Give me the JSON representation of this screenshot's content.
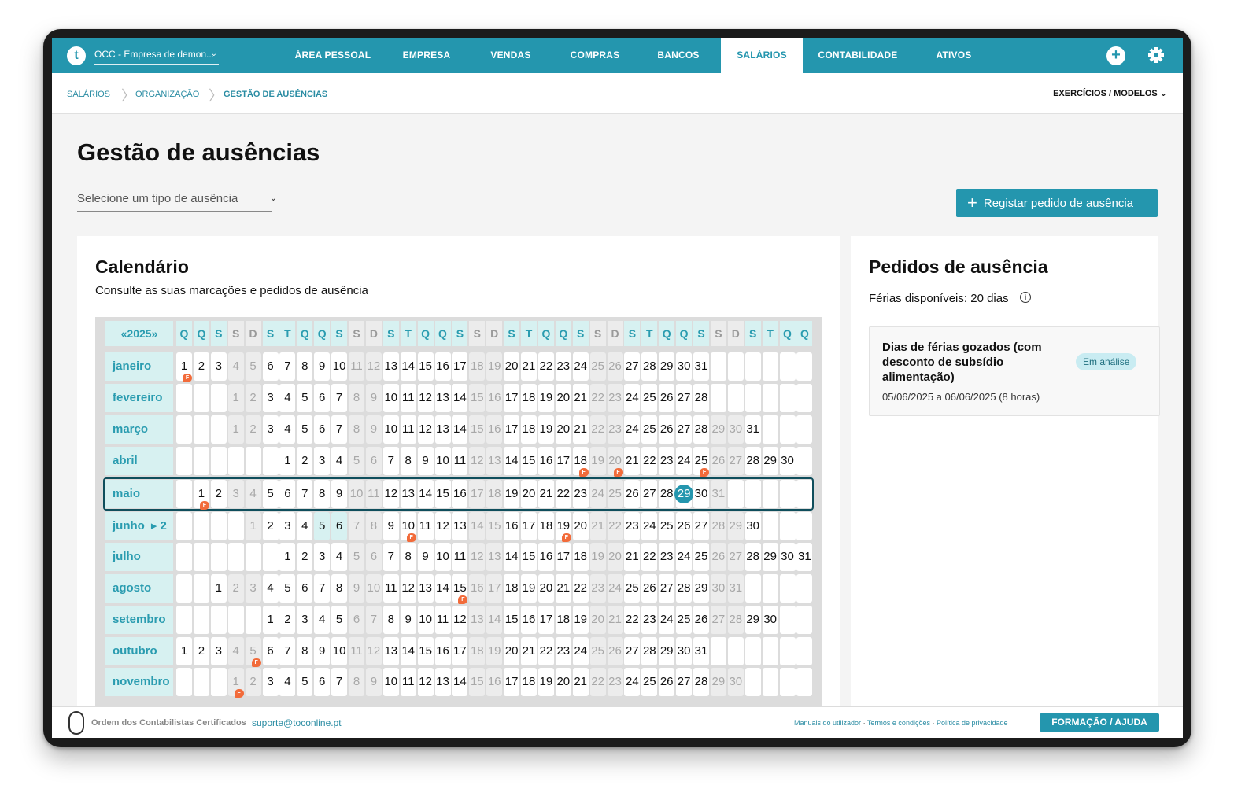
{
  "topbar": {
    "logo_letter": "t",
    "company": "OCC - Empresa de demon...",
    "nav": [
      {
        "label": "ÁREA PESSOAL",
        "active": false
      },
      {
        "label": "EMPRESA",
        "active": false
      },
      {
        "label": "VENDAS",
        "active": false
      },
      {
        "label": "COMPRAS",
        "active": false
      },
      {
        "label": "BANCOS",
        "active": false
      },
      {
        "label": "SALÁRIOS",
        "active": true
      },
      {
        "label": "CONTABILIDADE",
        "active": false
      },
      {
        "label": "ATIVOS",
        "active": false
      }
    ],
    "plus_icon": "plus-icon",
    "gear_icon": "gear-icon"
  },
  "breadcrumb": {
    "items": [
      "SALÁRIOS",
      "ORGANIZAÇÃO",
      "GESTÃO DE AUSÊNCIAS"
    ],
    "exercicios": "EXERCÍCIOS / MODELOS"
  },
  "page": {
    "title": "Gestão de ausências",
    "select_placeholder": "Selecione um tipo de ausência",
    "register_button": "Registar pedido de ausência"
  },
  "calendar": {
    "title": "Calendário",
    "subtitle": "Consulte as suas marcações e pedidos de ausência",
    "year": "2025",
    "weekday_header": [
      "Q",
      "Q",
      "S",
      "S",
      "D",
      "S",
      "T",
      "Q",
      "Q",
      "S",
      "S",
      "D",
      "S",
      "T",
      "Q",
      "Q",
      "S",
      "S",
      "D",
      "S",
      "T",
      "Q",
      "Q",
      "S",
      "S",
      "D",
      "S",
      "T",
      "Q",
      "Q",
      "S",
      "S",
      "D",
      "S",
      "T",
      "Q",
      "Q"
    ],
    "months": [
      {
        "name": "janeiro",
        "offset": 0,
        "days": 31,
        "flags": [
          1
        ]
      },
      {
        "name": "fevereiro",
        "offset": 3,
        "days": 28,
        "flags": []
      },
      {
        "name": "março",
        "offset": 3,
        "days": 31,
        "flags": []
      },
      {
        "name": "abril",
        "offset": 6,
        "days": 30,
        "flags": [
          18,
          20,
          25
        ]
      },
      {
        "name": "maio",
        "offset": 1,
        "days": 31,
        "flags": [
          1
        ],
        "today": 29
      },
      {
        "name": "junho",
        "suffix": "▸ 2",
        "offset": 4,
        "days": 30,
        "flags": [
          10,
          19
        ],
        "selected": [
          5,
          6
        ]
      },
      {
        "name": "julho",
        "offset": 6,
        "days": 31,
        "flags": []
      },
      {
        "name": "agosto",
        "offset": 2,
        "days": 31,
        "flags": [
          15
        ]
      },
      {
        "name": "setembro",
        "offset": 5,
        "days": 30,
        "flags": []
      },
      {
        "name": "outubro",
        "offset": 0,
        "days": 31,
        "flags": [
          5
        ]
      },
      {
        "name": "novembro",
        "offset": 3,
        "days": 30,
        "flags": [
          1
        ]
      }
    ],
    "flag_letter": "F"
  },
  "requests": {
    "title": "Pedidos de ausência",
    "available": "Férias disponíveis: 20 dias",
    "items": [
      {
        "title": "Dias de férias gozados (com desconto de subsídio alimentação)",
        "status": "Em análise",
        "dates": "05/06/2025 a 06/06/2025 (8 horas)"
      }
    ]
  },
  "footer": {
    "org": "Ordem dos Contabilistas Certificados",
    "email": "suporte@toconline.pt",
    "links": [
      "Manuais do utilizador",
      "Termos e condições",
      "Política de privacidade"
    ],
    "help_button": "FORMAÇÃO / AJUDA"
  },
  "colors": {
    "brand": "#2496ae",
    "header_cell": "#d7f1f1",
    "weekend": "#ececec",
    "flag": "#f26b3a"
  }
}
